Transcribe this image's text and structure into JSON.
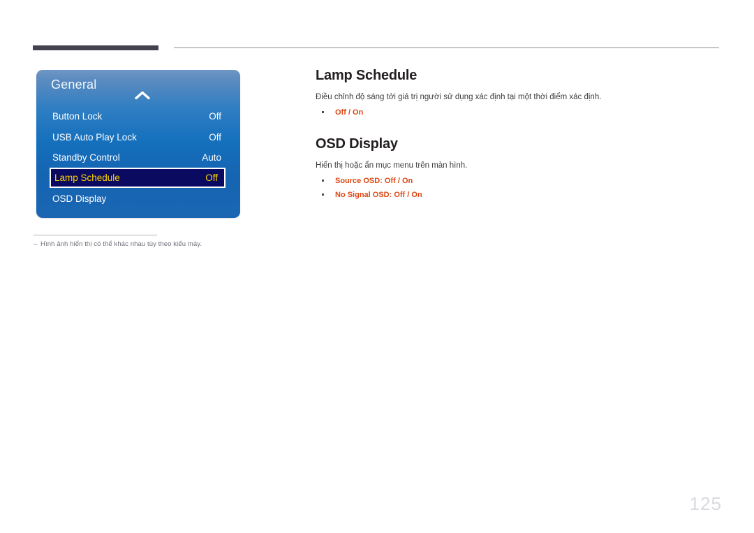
{
  "page": {
    "number": "125"
  },
  "osd_menu": {
    "title": "General",
    "collapse_icon": "chevron-up-icon",
    "rows": [
      {
        "label": "Button Lock",
        "value": "Off",
        "selected": false
      },
      {
        "label": "USB Auto Play Lock",
        "value": "Off",
        "selected": false
      },
      {
        "label": "Standby Control",
        "value": "Auto",
        "selected": false
      },
      {
        "label": "Lamp Schedule",
        "value": "Off",
        "selected": true
      },
      {
        "label": "OSD Display",
        "value": "",
        "selected": false
      }
    ],
    "colors": {
      "panel_top": "#6e97c4",
      "panel_bottom": "#1a66b3",
      "selected_bg": "#0a0a60",
      "selected_text": "#ffd400"
    }
  },
  "footnote": {
    "dash": "–",
    "text": "Hình ảnh hiển thị có thể khác nhau tùy theo kiểu máy."
  },
  "sections": [
    {
      "title": "Lamp Schedule",
      "description": "Điều chỉnh độ sáng tới giá trị người sử dụng xác định tại một thời điểm xác định.",
      "options": [
        "Off / On"
      ]
    },
    {
      "title": "OSD Display",
      "description": "Hiển thị hoặc ẩn mục menu trên màn hình.",
      "options": [
        "Source OSD: Off / On",
        "No Signal OSD: Off / On"
      ]
    }
  ],
  "accent_color": "#dd4814"
}
